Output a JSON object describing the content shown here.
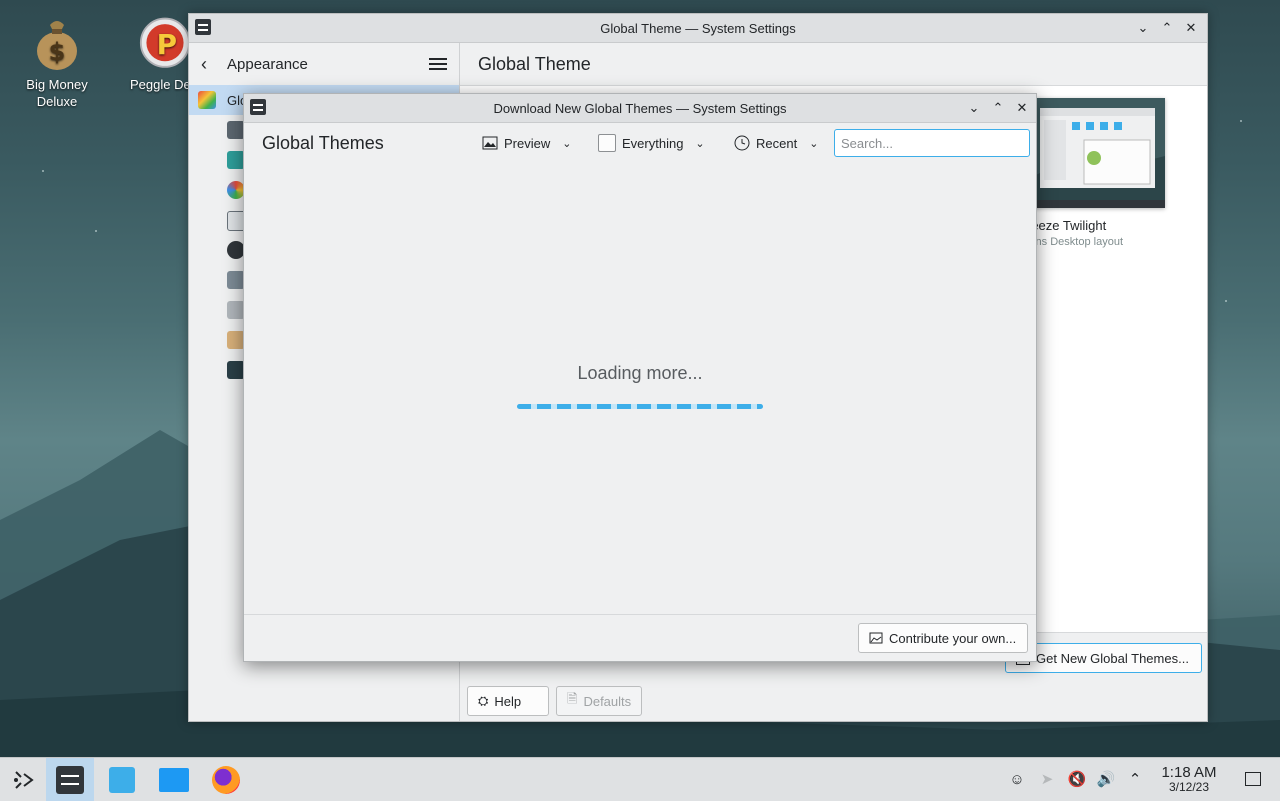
{
  "desktop": {
    "icons": [
      {
        "label": "Big Money\nDeluxe",
        "icon": "money-bag-icon"
      },
      {
        "label": "Peggle De",
        "icon": "peggle-icon"
      }
    ]
  },
  "main_window": {
    "title": "Global Theme — System Settings",
    "sidebar": {
      "back_label": "Appearance",
      "selected_item_partial": "Glo",
      "menu_icon": "hamburger-menu-icon"
    },
    "page_title": "Global Theme",
    "theme_card": {
      "name_partial": "reeze Twilight",
      "subtitle_partial": "ains Desktop layout"
    },
    "get_new_button": "Get New Global Themes...",
    "help_button": "Help",
    "defaults_button": "Defaults"
  },
  "dialog": {
    "window_title": "Download New Global Themes — System Settings",
    "title": "Global Themes",
    "preview_label": "Preview",
    "filter_label": "Everything",
    "sort_label": "Recent",
    "search_placeholder": "Search...",
    "loading_text": "Loading more...",
    "contribute_button": "Contribute your own..."
  },
  "taskbar": {
    "time": "1:18 AM",
    "date": "3/12/23"
  },
  "colors": {
    "accent": "#3daee9",
    "selection": "#c2daf2",
    "window_bg": "#eff0f1"
  }
}
